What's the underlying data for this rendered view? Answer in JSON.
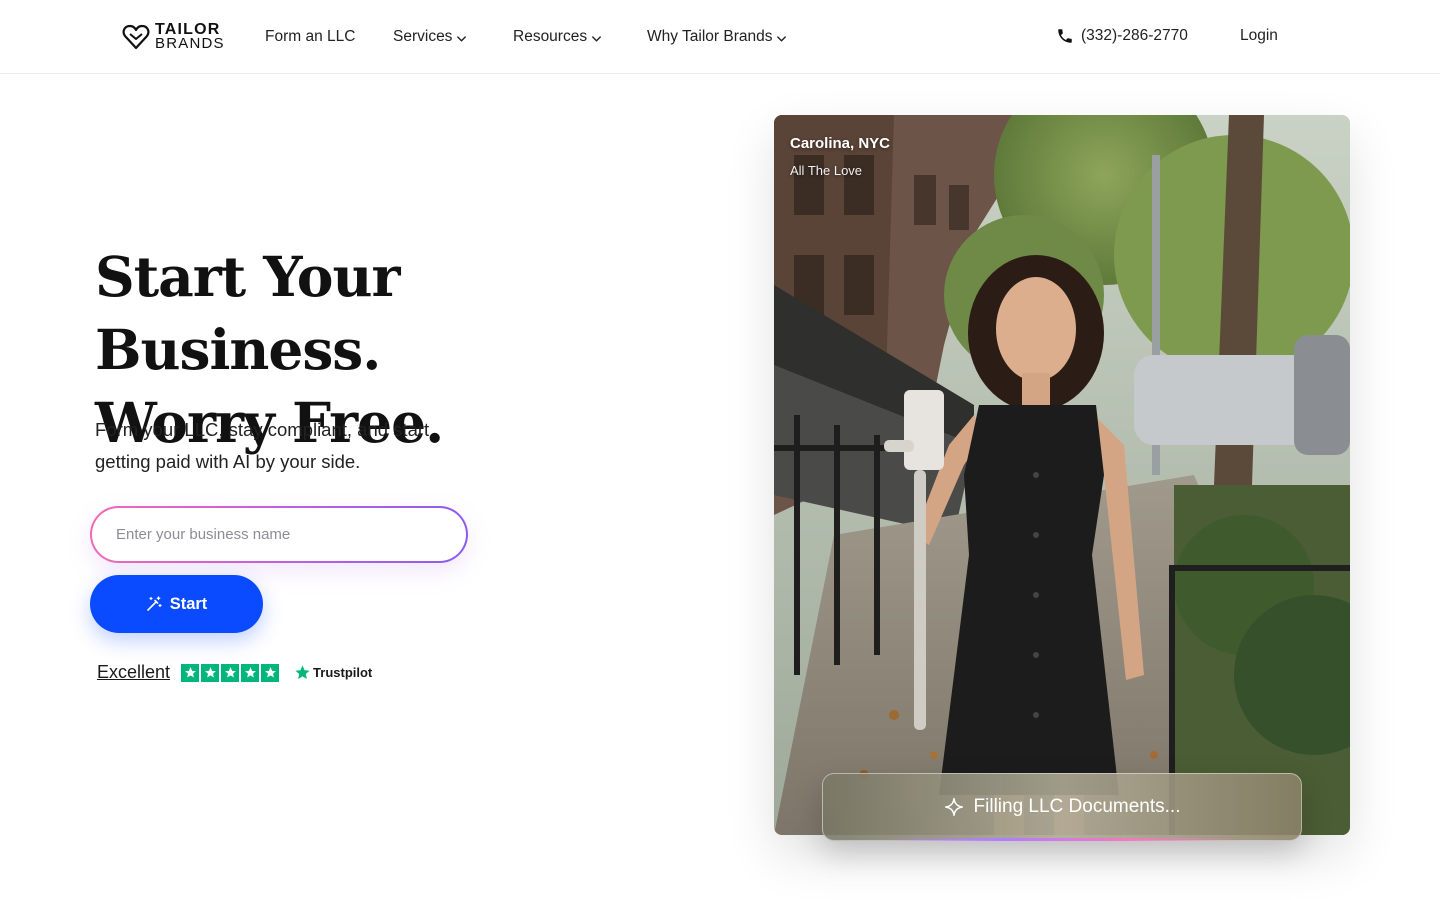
{
  "header": {
    "logo": {
      "line1": "TAILOR",
      "line2": "BRANDS",
      "icon": "heart-logo-icon"
    },
    "nav": [
      {
        "label": "Form an LLC",
        "has_dropdown": false
      },
      {
        "label": "Services",
        "has_dropdown": true
      },
      {
        "label": "Resources",
        "has_dropdown": true
      },
      {
        "label": "Why Tailor Brands",
        "has_dropdown": true
      }
    ],
    "phone": {
      "icon": "phone-icon",
      "number": "(332)-286-2770"
    },
    "login_label": "Login"
  },
  "hero": {
    "headline_line1": "Start Your Business.",
    "headline_line2": "Worry Free.",
    "subtext": "Form your LLC, stay compliant, and start getting paid with AI by your side.",
    "business_input": {
      "placeholder": "Enter your business name",
      "value": ""
    },
    "start_button": {
      "label": "Start",
      "icon": "magic-wand-icon"
    },
    "trustpilot": {
      "rating_text": "Excellent",
      "stars": 5,
      "brand": "Trustpilot"
    }
  },
  "showcase": {
    "person_location": "Carolina, NYC",
    "business_name": "All The Love",
    "status": {
      "icon": "sparkle-icon",
      "text": "Filling LLC Documents..."
    }
  },
  "colors": {
    "primary_button": "#0a4bff",
    "trustpilot_green": "#00b67a",
    "input_gradient_start": "#f06ab4",
    "input_gradient_end": "#8a5cf0"
  }
}
